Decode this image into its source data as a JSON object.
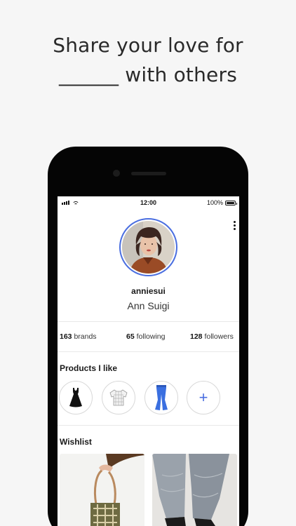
{
  "headline": {
    "line1": "Share your love for",
    "line2": "______ with others"
  },
  "status_bar": {
    "time": "12:00",
    "battery": "100%",
    "battery_level": 1.0
  },
  "profile": {
    "username": "anniesui",
    "full_name": "Ann Suigi",
    "menu_icon": "more-vertical-icon"
  },
  "stats": {
    "brands_count": "163",
    "brands_label": "brands",
    "following_count": "65",
    "following_label": "following",
    "followers_count": "128",
    "followers_label": "followers"
  },
  "products": {
    "title": "Products I like",
    "items": [
      {
        "icon": "black-dress-icon"
      },
      {
        "icon": "plaid-shirt-icon"
      },
      {
        "icon": "blue-flare-pants-icon"
      },
      {
        "icon": "plus-icon",
        "label": "+"
      }
    ]
  },
  "wishlist": {
    "title": "Wishlist",
    "items": [
      {
        "image": "woven-handbag-photo"
      },
      {
        "image": "jeans-and-shoes-photo"
      }
    ]
  },
  "colors": {
    "accent": "#4a6ee0",
    "background": "#f6f6f6",
    "phone": "#050505"
  }
}
